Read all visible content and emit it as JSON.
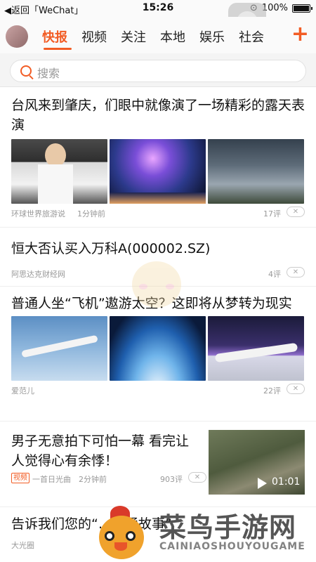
{
  "status_bar": {
    "back_label": "◀返回「WeChat」",
    "time": "15:26",
    "battery": "100%",
    "rotation_lock_icon": "rotation-lock-icon"
  },
  "tabs": {
    "items": [
      "快报",
      "视频",
      "关注",
      "本地",
      "娱乐",
      "社会"
    ],
    "active": "快报",
    "add_icon": "plus-icon"
  },
  "search": {
    "placeholder": "搜索"
  },
  "colors": {
    "accent": "#f25c24"
  },
  "articles": [
    {
      "title": "台风来到肇庆，们眼中就像演了一场精彩的露天表演",
      "source": "环球世界旅游说",
      "time": "1分钟前",
      "comments": "17评"
    },
    {
      "title": "恒大否认买入万科A(000002.SZ)",
      "source": "阿思达克财经网",
      "comments": "4评"
    },
    {
      "title": "普通人坐“飞机”遨游太空？这即将从梦转为现实",
      "source": "爱范儿",
      "comments": "22评"
    },
    {
      "title": "男子无意拍下可怕一幕 看完让人觉得心有余悸！",
      "badge": "视频",
      "source": "一首日光曲",
      "time": "2分钟前",
      "comments": "903评",
      "duration": "01:01"
    },
    {
      "title": "告诉我们您的“…交通故事”",
      "source": "大光圈"
    }
  ],
  "watermark": {
    "cn": "菜鸟手游网",
    "en": "CAINIAOSHOUYOUGAME"
  }
}
